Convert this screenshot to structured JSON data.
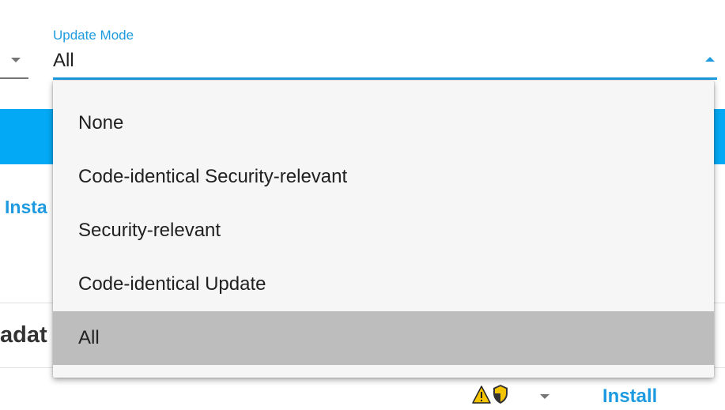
{
  "update_mode_select": {
    "label": "Update Mode",
    "value": "All",
    "options": [
      "None",
      "Code-identical Security-relevant",
      "Security-relevant",
      "Code-identical Update",
      "All"
    ],
    "selected_index": 4
  },
  "background": {
    "install_link_partial": "Insta",
    "heading_partial": "adat",
    "row_install_label": "Install",
    "icons": [
      "caret-down-icon",
      "warning-icon",
      "shield-icon",
      "chevron-down-icon"
    ]
  },
  "colors": {
    "accent": "#1e9be0",
    "blue_bar": "#03a9f4",
    "selected_item_bg": "#bdbdbd",
    "menu_bg": "#f6f6f6",
    "warning_yellow": "#f5c400"
  }
}
